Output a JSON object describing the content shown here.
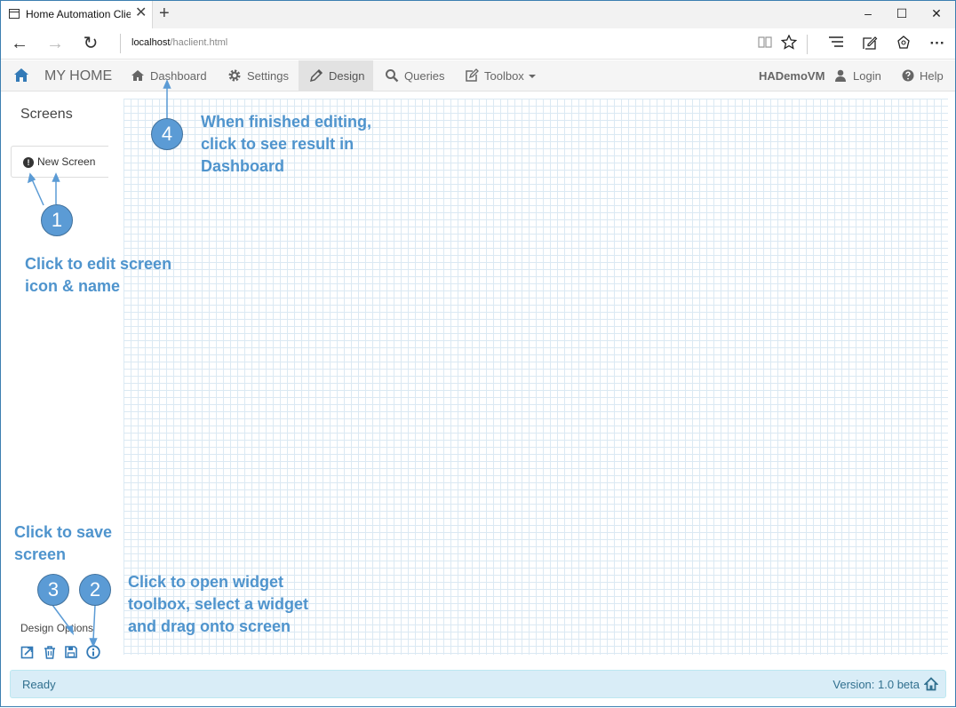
{
  "browser": {
    "tab_title": "Home Automation Clien",
    "tab_close": "✕",
    "new_tab": "+",
    "url_host": "localhost",
    "url_path": "/haclient.html",
    "minimize": "–",
    "maximize": "☐",
    "close": "✕",
    "back": "←",
    "forward": "→",
    "refresh": "↻",
    "toolbar_icons": [
      "reading-view-icon",
      "favorite-icon",
      "hub-icon",
      "web-note-icon",
      "share-icon",
      "more-icon"
    ]
  },
  "navbar": {
    "brand": "MY HOME",
    "items": [
      {
        "label": "Dashboard",
        "icon": "home-icon"
      },
      {
        "label": "Settings",
        "icon": "gear-icon"
      },
      {
        "label": "Design",
        "icon": "pencil-icon"
      },
      {
        "label": "Queries",
        "icon": "search-icon"
      },
      {
        "label": "Toolbox",
        "icon": "edit-icon"
      }
    ],
    "host": "HADemoVM",
    "login": "Login",
    "help": "Help"
  },
  "sidebar": {
    "title": "Screens",
    "screen_button": "New Screen",
    "design_options": "Design Options",
    "option_icons": [
      "export-icon",
      "trash-icon",
      "save-icon",
      "widget-icon"
    ]
  },
  "status": {
    "text": "Ready",
    "version": "Version: 1.0 beta"
  },
  "annotations": {
    "callout1": "1",
    "callout2": "2",
    "callout3": "3",
    "callout4": "4",
    "text1_line1": "Click to edit screen",
    "text1_line2": "icon & name",
    "text2_line1": "Click to open widget",
    "text2_line2": "toolbox, select a widget",
    "text2_line3": "and drag onto screen",
    "text3_line1": "Click to save",
    "text3_line2": "screen",
    "text4_line1": "When finished editing,",
    "text4_line2": "click to see result in",
    "text4_line3": "Dashboard"
  },
  "colors": {
    "annotation": "#4f94cd",
    "callout_fill": "#5b9bd5",
    "status_bg": "#d9edf7",
    "status_text": "#31708f",
    "brand_icon": "#337ab7"
  }
}
